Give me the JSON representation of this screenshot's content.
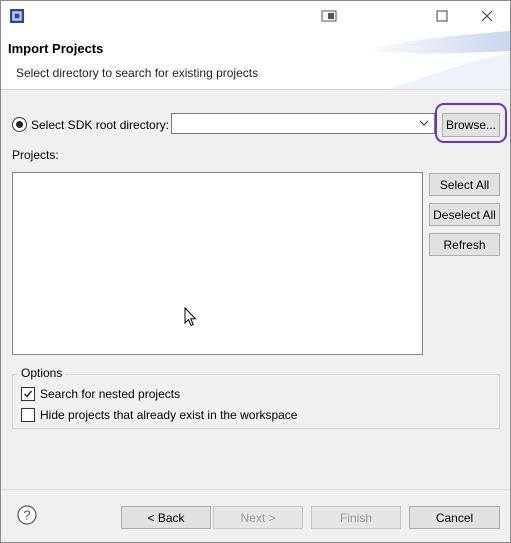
{
  "window": {
    "icons": {
      "app": "chip-app-icon",
      "snap": "snap-layout-icon",
      "maximize": "maximize-icon",
      "close": "close-icon"
    }
  },
  "header": {
    "title": "Import Projects",
    "description": "Select directory to search for existing projects"
  },
  "source": {
    "radio_label": "Select SDK root directory:",
    "radio_selected": true,
    "combo_value": "",
    "browse_label": "Browse..."
  },
  "projects": {
    "label": "Projects:",
    "items": [],
    "select_all_label": "Select All",
    "deselect_all_label": "Deselect All",
    "refresh_label": "Refresh"
  },
  "options": {
    "legend": "Options",
    "search_nested": {
      "label": "Search for nested projects",
      "checked": true
    },
    "hide_existing": {
      "label": "Hide projects that already exist in the workspace",
      "checked": false
    }
  },
  "footer": {
    "back_label": "< Back",
    "next_label": "Next >",
    "finish_label": "Finish",
    "cancel_label": "Cancel",
    "help_icon": "help-icon"
  },
  "colors": {
    "highlight": "#6a2fe0",
    "app_icon": "#2f43a8"
  }
}
